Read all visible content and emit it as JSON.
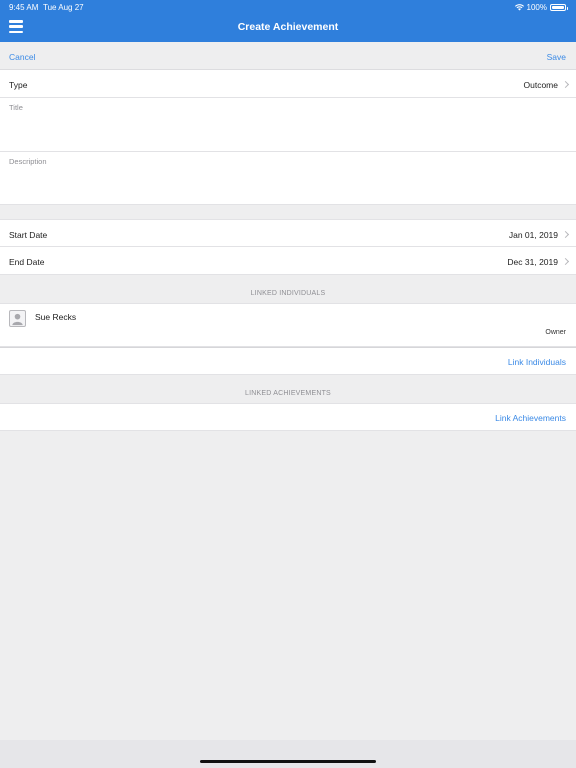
{
  "status": {
    "time": "9:45 AM",
    "date": "Tue Aug 27",
    "battery": "100%"
  },
  "header": {
    "title": "Create Achievement"
  },
  "actions": {
    "cancel": "Cancel",
    "save": "Save"
  },
  "form": {
    "type_label": "Type",
    "type_value": "Outcome",
    "title_label": "Title",
    "description_label": "Description",
    "start_label": "Start Date",
    "start_value": "Jan 01, 2019",
    "end_label": "End Date",
    "end_value": "Dec 31, 2019"
  },
  "linked_individuals": {
    "header": "LINKED INDIVIDUALS",
    "people": [
      {
        "name": "Sue Recks",
        "role": "Owner"
      }
    ],
    "link_label": "Link Individuals"
  },
  "linked_achievements": {
    "header": "LINKED ACHIEVEMENTS",
    "link_label": "Link Achievements"
  },
  "colors": {
    "header_bg": "#2f7fdc",
    "accent": "#3b8ae6",
    "background": "#eeeeef"
  }
}
